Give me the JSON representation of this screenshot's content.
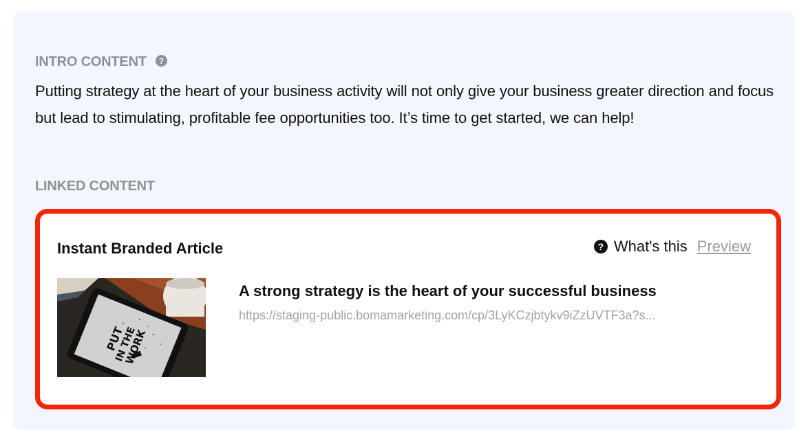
{
  "intro": {
    "label": "INTRO CONTENT",
    "help_icon": "question-circle-icon",
    "text": "Putting strategy at the heart of your business activity will not only give your business greater direction and focus but lead to stimulating, profitable fee opportunities too. It’s time to get started, we can help!"
  },
  "linked": {
    "label": "LINKED CONTENT",
    "card": {
      "title": "Instant Branded Article",
      "whats_this_label": "What's this",
      "help_icon": "question-circle-icon",
      "preview_label": "Preview",
      "highlight_color": "#f0260a",
      "thumbnail_text": "PUT IN THE WORK",
      "article_title": "A strong strategy is the heart of your successful business",
      "article_url": "https://staging-public.bomamarketing.com/cp/3LyKCzjbtykv9iZzUVTF3a?s..."
    }
  },
  "colors": {
    "panel_background": "#f3f6fd",
    "label_gray": "#8f9196",
    "url_gray": "#a3a3a3"
  }
}
